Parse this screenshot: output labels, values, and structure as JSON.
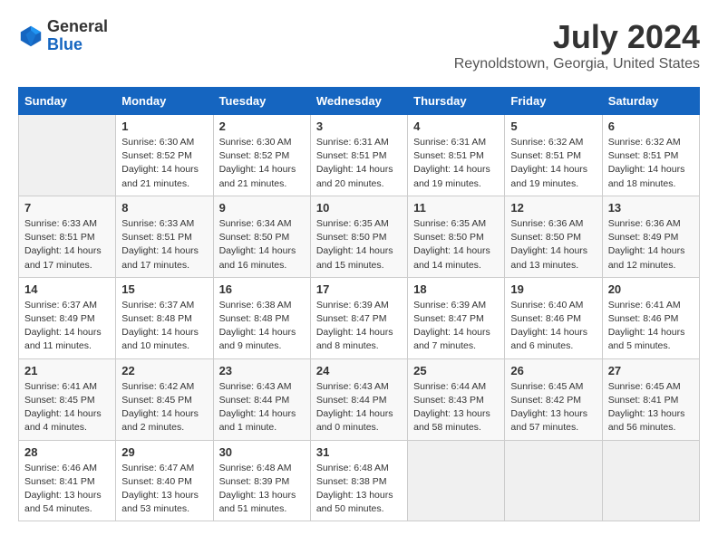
{
  "header": {
    "logo_line1": "General",
    "logo_line2": "Blue",
    "title": "July 2024",
    "subtitle": "Reynoldstown, Georgia, United States"
  },
  "days_of_week": [
    "Sunday",
    "Monday",
    "Tuesday",
    "Wednesday",
    "Thursday",
    "Friday",
    "Saturday"
  ],
  "weeks": [
    [
      {
        "day": "",
        "info": ""
      },
      {
        "day": "1",
        "info": "Sunrise: 6:30 AM\nSunset: 8:52 PM\nDaylight: 14 hours\nand 21 minutes."
      },
      {
        "day": "2",
        "info": "Sunrise: 6:30 AM\nSunset: 8:52 PM\nDaylight: 14 hours\nand 21 minutes."
      },
      {
        "day": "3",
        "info": "Sunrise: 6:31 AM\nSunset: 8:51 PM\nDaylight: 14 hours\nand 20 minutes."
      },
      {
        "day": "4",
        "info": "Sunrise: 6:31 AM\nSunset: 8:51 PM\nDaylight: 14 hours\nand 19 minutes."
      },
      {
        "day": "5",
        "info": "Sunrise: 6:32 AM\nSunset: 8:51 PM\nDaylight: 14 hours\nand 19 minutes."
      },
      {
        "day": "6",
        "info": "Sunrise: 6:32 AM\nSunset: 8:51 PM\nDaylight: 14 hours\nand 18 minutes."
      }
    ],
    [
      {
        "day": "7",
        "info": "Sunrise: 6:33 AM\nSunset: 8:51 PM\nDaylight: 14 hours\nand 17 minutes."
      },
      {
        "day": "8",
        "info": "Sunrise: 6:33 AM\nSunset: 8:51 PM\nDaylight: 14 hours\nand 17 minutes."
      },
      {
        "day": "9",
        "info": "Sunrise: 6:34 AM\nSunset: 8:50 PM\nDaylight: 14 hours\nand 16 minutes."
      },
      {
        "day": "10",
        "info": "Sunrise: 6:35 AM\nSunset: 8:50 PM\nDaylight: 14 hours\nand 15 minutes."
      },
      {
        "day": "11",
        "info": "Sunrise: 6:35 AM\nSunset: 8:50 PM\nDaylight: 14 hours\nand 14 minutes."
      },
      {
        "day": "12",
        "info": "Sunrise: 6:36 AM\nSunset: 8:50 PM\nDaylight: 14 hours\nand 13 minutes."
      },
      {
        "day": "13",
        "info": "Sunrise: 6:36 AM\nSunset: 8:49 PM\nDaylight: 14 hours\nand 12 minutes."
      }
    ],
    [
      {
        "day": "14",
        "info": "Sunrise: 6:37 AM\nSunset: 8:49 PM\nDaylight: 14 hours\nand 11 minutes."
      },
      {
        "day": "15",
        "info": "Sunrise: 6:37 AM\nSunset: 8:48 PM\nDaylight: 14 hours\nand 10 minutes."
      },
      {
        "day": "16",
        "info": "Sunrise: 6:38 AM\nSunset: 8:48 PM\nDaylight: 14 hours\nand 9 minutes."
      },
      {
        "day": "17",
        "info": "Sunrise: 6:39 AM\nSunset: 8:47 PM\nDaylight: 14 hours\nand 8 minutes."
      },
      {
        "day": "18",
        "info": "Sunrise: 6:39 AM\nSunset: 8:47 PM\nDaylight: 14 hours\nand 7 minutes."
      },
      {
        "day": "19",
        "info": "Sunrise: 6:40 AM\nSunset: 8:46 PM\nDaylight: 14 hours\nand 6 minutes."
      },
      {
        "day": "20",
        "info": "Sunrise: 6:41 AM\nSunset: 8:46 PM\nDaylight: 14 hours\nand 5 minutes."
      }
    ],
    [
      {
        "day": "21",
        "info": "Sunrise: 6:41 AM\nSunset: 8:45 PM\nDaylight: 14 hours\nand 4 minutes."
      },
      {
        "day": "22",
        "info": "Sunrise: 6:42 AM\nSunset: 8:45 PM\nDaylight: 14 hours\nand 2 minutes."
      },
      {
        "day": "23",
        "info": "Sunrise: 6:43 AM\nSunset: 8:44 PM\nDaylight: 14 hours\nand 1 minute."
      },
      {
        "day": "24",
        "info": "Sunrise: 6:43 AM\nSunset: 8:44 PM\nDaylight: 14 hours\nand 0 minutes."
      },
      {
        "day": "25",
        "info": "Sunrise: 6:44 AM\nSunset: 8:43 PM\nDaylight: 13 hours\nand 58 minutes."
      },
      {
        "day": "26",
        "info": "Sunrise: 6:45 AM\nSunset: 8:42 PM\nDaylight: 13 hours\nand 57 minutes."
      },
      {
        "day": "27",
        "info": "Sunrise: 6:45 AM\nSunset: 8:41 PM\nDaylight: 13 hours\nand 56 minutes."
      }
    ],
    [
      {
        "day": "28",
        "info": "Sunrise: 6:46 AM\nSunset: 8:41 PM\nDaylight: 13 hours\nand 54 minutes."
      },
      {
        "day": "29",
        "info": "Sunrise: 6:47 AM\nSunset: 8:40 PM\nDaylight: 13 hours\nand 53 minutes."
      },
      {
        "day": "30",
        "info": "Sunrise: 6:48 AM\nSunset: 8:39 PM\nDaylight: 13 hours\nand 51 minutes."
      },
      {
        "day": "31",
        "info": "Sunrise: 6:48 AM\nSunset: 8:38 PM\nDaylight: 13 hours\nand 50 minutes."
      },
      {
        "day": "",
        "info": ""
      },
      {
        "day": "",
        "info": ""
      },
      {
        "day": "",
        "info": ""
      }
    ]
  ]
}
